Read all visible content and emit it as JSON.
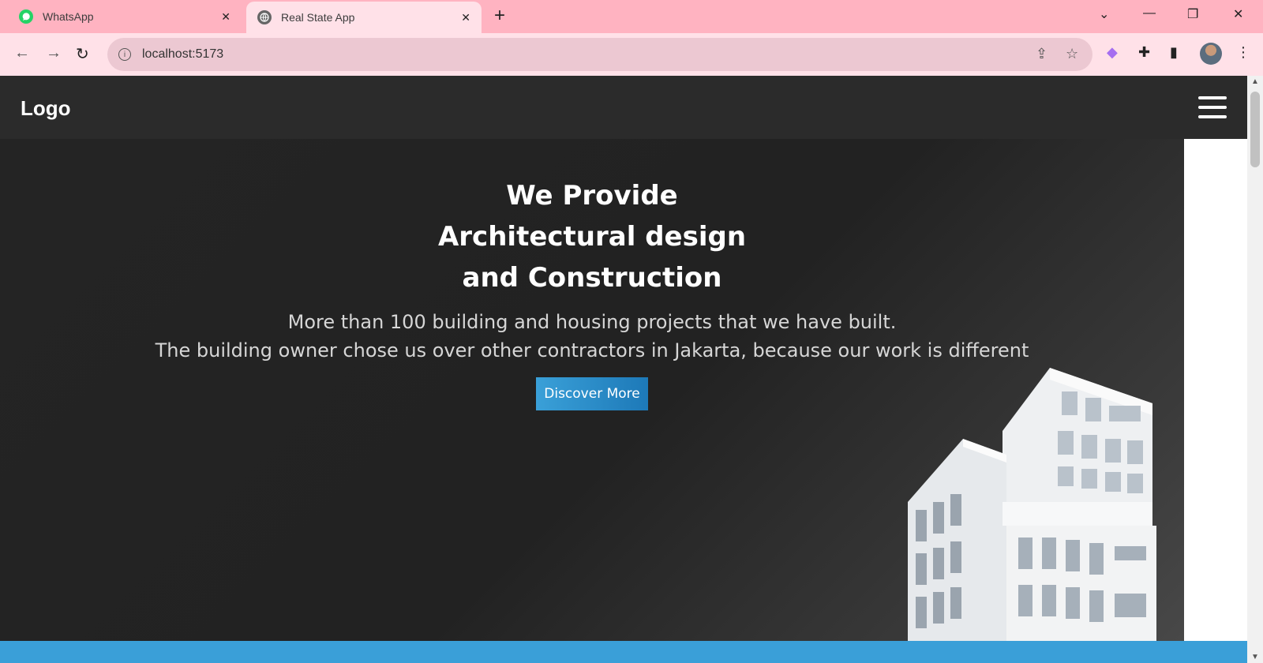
{
  "browser": {
    "tabs": [
      {
        "title": "WhatsApp",
        "icon": "whatsapp-icon"
      },
      {
        "title": "Real State App",
        "icon": "globe-icon",
        "active": true
      }
    ],
    "address": "localhost:5173",
    "colors": {
      "tabbar": "#ffb3c1",
      "toolbar": "#ffe1e8",
      "omnibox": "#ecc8d2"
    }
  },
  "site": {
    "logo": "Logo",
    "hero": {
      "title_lines": [
        "We Provide",
        "Architectural design",
        "and Construction"
      ],
      "subtitle_lines": [
        "More than 100 building and housing projects that we have built.",
        "The building owner chose us over other contractors in Jakarta, because our work is different"
      ],
      "cta_label": "Discover More"
    },
    "colors": {
      "header": "#2b2b2b",
      "accent": "#3a9fd8"
    }
  }
}
